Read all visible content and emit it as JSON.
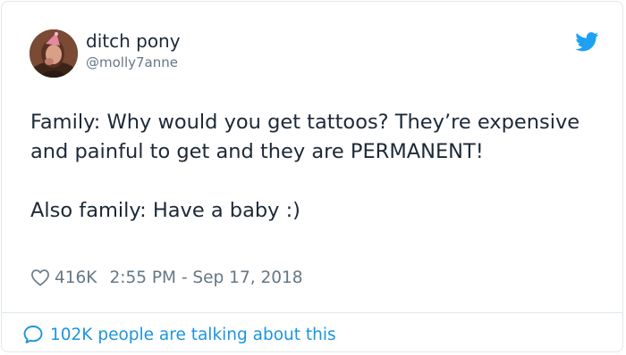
{
  "author": {
    "display_name": "ditch pony",
    "handle": "@molly7anne"
  },
  "tweet": {
    "lines": [
      "Family: Why would you get tattoos? They’re expensive and painful to get and they are PERMANENT!",
      "Also family: Have a baby :)"
    ]
  },
  "meta": {
    "likes": "416K",
    "timestamp": "2:55 PM - Sep 17, 2018"
  },
  "footer": {
    "label": "102K people are talking about this"
  },
  "colors": {
    "brand": "#1da1f2",
    "link": "#1b95e0",
    "text": "#1c2938",
    "muted": "#657786",
    "border": "#e1e8ed"
  },
  "icons": [
    "avatar",
    "twitter-bird-icon",
    "heart-icon",
    "speech-bubble-icon"
  ]
}
